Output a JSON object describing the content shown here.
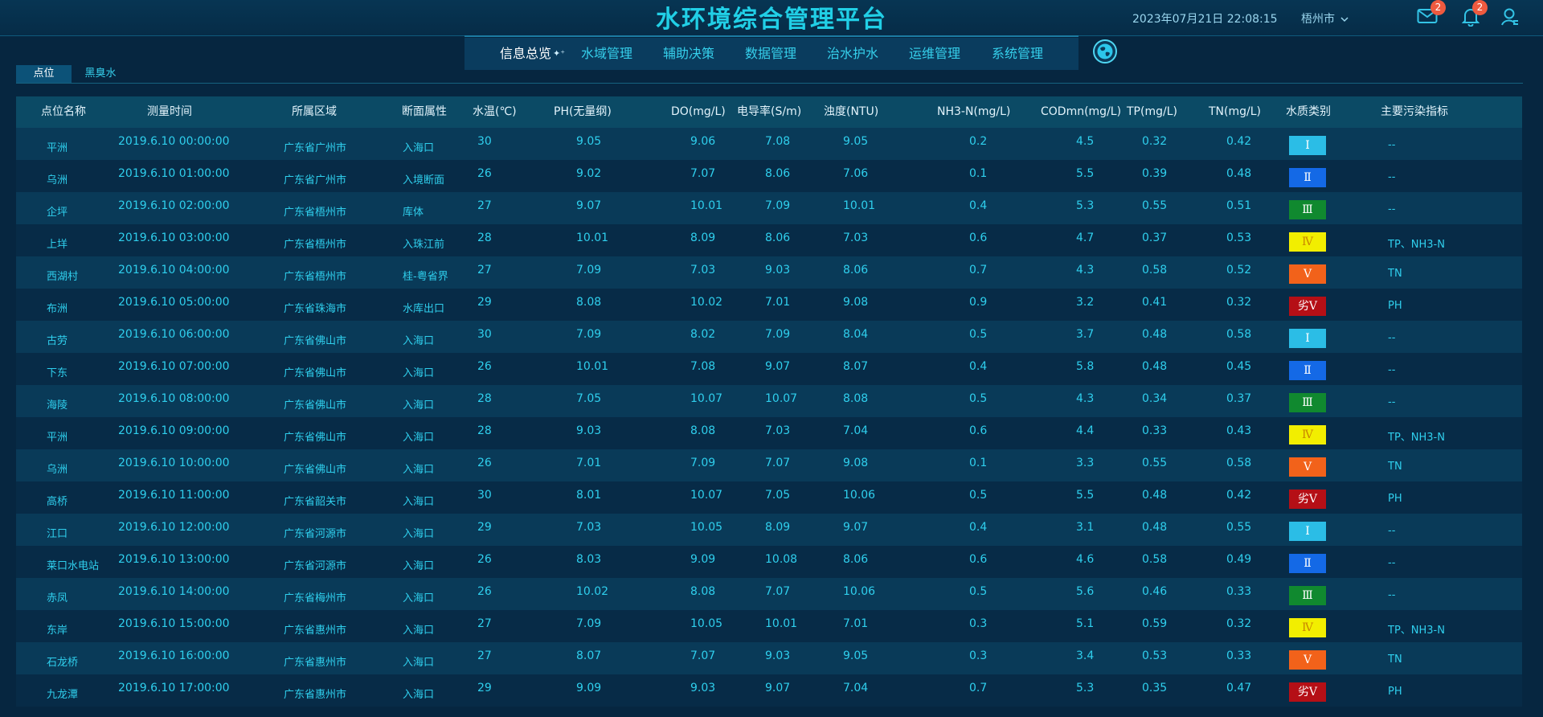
{
  "header": {
    "title": "水环境综合管理平台",
    "datetime": "2023年07月21日 22:08:15",
    "city": "梧州市",
    "mail_count": "2",
    "notify_count": "2",
    "icons": [
      "mail-icon",
      "bell-icon",
      "user-icon",
      "globe-icon"
    ]
  },
  "nav": {
    "items": [
      {
        "label": "信息总览",
        "active": true
      },
      {
        "label": "水域管理"
      },
      {
        "label": "辅助决策"
      },
      {
        "label": "数据管理"
      },
      {
        "label": "治水护水"
      },
      {
        "label": "运维管理"
      },
      {
        "label": "系统管理"
      }
    ]
  },
  "tabs": [
    {
      "label": "点位",
      "active": true
    },
    {
      "label": "黑臭水"
    }
  ],
  "table": {
    "headers": [
      "点位名称",
      "测量时间",
      "所属区域",
      "断面属性",
      "水温(℃)",
      "PH(无量纲)",
      "DO(mg/L)",
      "电导率(S/m)",
      "浊度(NTU)",
      "NH3-N(mg/L)",
      "CODmn(mg/L)",
      "TP(mg/L)",
      "TN(mg/L)",
      "水质类别",
      "主要污染指标"
    ],
    "class_colors": {
      "Ⅰ": "#2bbde6",
      "Ⅱ": "#1469e6",
      "Ⅲ": "#10892f",
      "Ⅳ": "#f2ee00",
      "Ⅴ": "#f2621a",
      "劣Ⅴ": "#b50f16"
    },
    "rows": [
      {
        "name": "平洲",
        "time": "2019.6.10 00:00:00",
        "region": "广东省广州市",
        "section": "入海口",
        "temp": "30",
        "ph": "9.05",
        "do": "9.06",
        "cond": "7.08",
        "turb": "9.05",
        "nh3": "0.2",
        "cod": "4.5",
        "tp": "0.32",
        "tn": "0.42",
        "class": "Ⅰ",
        "pollutant": "--"
      },
      {
        "name": "乌洲",
        "time": "2019.6.10 01:00:00",
        "region": "广东省广州市",
        "section": "入境断面",
        "temp": "26",
        "ph": "9.02",
        "do": "7.07",
        "cond": "8.06",
        "turb": "7.06",
        "nh3": "0.1",
        "cod": "5.5",
        "tp": "0.39",
        "tn": "0.48",
        "class": "Ⅱ",
        "pollutant": "--"
      },
      {
        "name": "企坪",
        "time": "2019.6.10 02:00:00",
        "region": "广东省梧州市",
        "section": "库体",
        "temp": "27",
        "ph": "9.07",
        "do": "10.01",
        "cond": "7.09",
        "turb": "10.01",
        "nh3": "0.4",
        "cod": "5.3",
        "tp": "0.55",
        "tn": "0.51",
        "class": "Ⅲ",
        "pollutant": "--"
      },
      {
        "name": "上垟",
        "time": "2019.6.10 03:00:00",
        "region": "广东省梧州市",
        "section": "入珠江前",
        "temp": "28",
        "ph": "10.01",
        "do": "8.09",
        "cond": "8.06",
        "turb": "7.03",
        "nh3": "0.6",
        "cod": "4.7",
        "tp": "0.37",
        "tn": "0.53",
        "class": "Ⅳ",
        "pollutant": "TP、NH3-N"
      },
      {
        "name": "西湖村",
        "time": "2019.6.10 04:00:00",
        "region": "广东省梧州市",
        "section": "桂-粤省界",
        "temp": "27",
        "ph": "7.09",
        "do": "7.03",
        "cond": "9.03",
        "turb": "8.06",
        "nh3": "0.7",
        "cod": "4.3",
        "tp": "0.58",
        "tn": "0.52",
        "class": "Ⅴ",
        "pollutant": "TN"
      },
      {
        "name": "布洲",
        "time": "2019.6.10 05:00:00",
        "region": "广东省珠海市",
        "section": "水库出口",
        "temp": "29",
        "ph": "8.08",
        "do": "10.02",
        "cond": "7.01",
        "turb": "9.08",
        "nh3": "0.9",
        "cod": "3.2",
        "tp": "0.41",
        "tn": "0.32",
        "class": "劣Ⅴ",
        "pollutant": "PH"
      },
      {
        "name": "古劳",
        "time": "2019.6.10 06:00:00",
        "region": "广东省佛山市",
        "section": "入海口",
        "temp": "30",
        "ph": "7.09",
        "do": "8.02",
        "cond": "7.09",
        "turb": "8.04",
        "nh3": "0.5",
        "cod": "3.7",
        "tp": "0.48",
        "tn": "0.58",
        "class": "Ⅰ",
        "pollutant": "--"
      },
      {
        "name": "下东",
        "time": "2019.6.10 07:00:00",
        "region": "广东省佛山市",
        "section": "入海口",
        "temp": "26",
        "ph": "10.01",
        "do": "7.08",
        "cond": "9.07",
        "turb": "8.07",
        "nh3": "0.4",
        "cod": "5.8",
        "tp": "0.48",
        "tn": "0.45",
        "class": "Ⅱ",
        "pollutant": "--"
      },
      {
        "name": "海陵",
        "time": "2019.6.10 08:00:00",
        "region": "广东省佛山市",
        "section": "入海口",
        "temp": "28",
        "ph": "7.05",
        "do": "10.07",
        "cond": "10.07",
        "turb": "8.08",
        "nh3": "0.5",
        "cod": "4.3",
        "tp": "0.34",
        "tn": "0.37",
        "class": "Ⅲ",
        "pollutant": "--"
      },
      {
        "name": "平洲",
        "time": "2019.6.10 09:00:00",
        "region": "广东省佛山市",
        "section": "入海口",
        "temp": "28",
        "ph": "9.03",
        "do": "8.08",
        "cond": "7.03",
        "turb": "7.04",
        "nh3": "0.6",
        "cod": "4.4",
        "tp": "0.33",
        "tn": "0.43",
        "class": "Ⅳ",
        "pollutant": "TP、NH3-N"
      },
      {
        "name": "乌洲",
        "time": "2019.6.10 10:00:00",
        "region": "广东省佛山市",
        "section": "入海口",
        "temp": "26",
        "ph": "7.01",
        "do": "7.09",
        "cond": "7.07",
        "turb": "9.08",
        "nh3": "0.1",
        "cod": "3.3",
        "tp": "0.55",
        "tn": "0.58",
        "class": "Ⅴ",
        "pollutant": "TN"
      },
      {
        "name": "高桥",
        "time": "2019.6.10 11:00:00",
        "region": "广东省韶关市",
        "section": "入海口",
        "temp": "30",
        "ph": "8.01",
        "do": "10.07",
        "cond": "7.05",
        "turb": "10.06",
        "nh3": "0.5",
        "cod": "5.5",
        "tp": "0.48",
        "tn": "0.42",
        "class": "劣Ⅴ",
        "pollutant": "PH"
      },
      {
        "name": "江口",
        "time": "2019.6.10 12:00:00",
        "region": "广东省河源市",
        "section": "入海口",
        "temp": "29",
        "ph": "7.03",
        "do": "10.05",
        "cond": "8.09",
        "turb": "9.07",
        "nh3": "0.4",
        "cod": "3.1",
        "tp": "0.48",
        "tn": "0.55",
        "class": "Ⅰ",
        "pollutant": "--"
      },
      {
        "name": "莱口水电站",
        "time": "2019.6.10 13:00:00",
        "region": "广东省河源市",
        "section": "入海口",
        "temp": "26",
        "ph": "8.03",
        "do": "9.09",
        "cond": "10.08",
        "turb": "8.06",
        "nh3": "0.6",
        "cod": "4.6",
        "tp": "0.58",
        "tn": "0.49",
        "class": "Ⅱ",
        "pollutant": "--"
      },
      {
        "name": "赤凤",
        "time": "2019.6.10 14:00:00",
        "region": "广东省梅州市",
        "section": "入海口",
        "temp": "26",
        "ph": "10.02",
        "do": "8.08",
        "cond": "7.07",
        "turb": "10.06",
        "nh3": "0.5",
        "cod": "5.6",
        "tp": "0.46",
        "tn": "0.33",
        "class": "Ⅲ",
        "pollutant": "--"
      },
      {
        "name": "东岸",
        "time": "2019.6.10 15:00:00",
        "region": "广东省惠州市",
        "section": "入海口",
        "temp": "27",
        "ph": "7.09",
        "do": "10.05",
        "cond": "10.01",
        "turb": "7.01",
        "nh3": "0.3",
        "cod": "5.1",
        "tp": "0.59",
        "tn": "0.32",
        "class": "Ⅳ",
        "pollutant": "TP、NH3-N"
      },
      {
        "name": "石龙桥",
        "time": "2019.6.10 16:00:00",
        "region": "广东省惠州市",
        "section": "入海口",
        "temp": "27",
        "ph": "8.07",
        "do": "7.07",
        "cond": "9.03",
        "turb": "9.05",
        "nh3": "0.3",
        "cod": "3.4",
        "tp": "0.53",
        "tn": "0.33",
        "class": "Ⅴ",
        "pollutant": "TN"
      },
      {
        "name": "九龙潭",
        "time": "2019.6.10 17:00:00",
        "region": "广东省惠州市",
        "section": "入海口",
        "temp": "29",
        "ph": "9.09",
        "do": "9.03",
        "cond": "9.07",
        "turb": "7.04",
        "nh3": "0.7",
        "cod": "5.3",
        "tp": "0.35",
        "tn": "0.47",
        "class": "劣Ⅴ",
        "pollutant": "PH"
      }
    ]
  }
}
